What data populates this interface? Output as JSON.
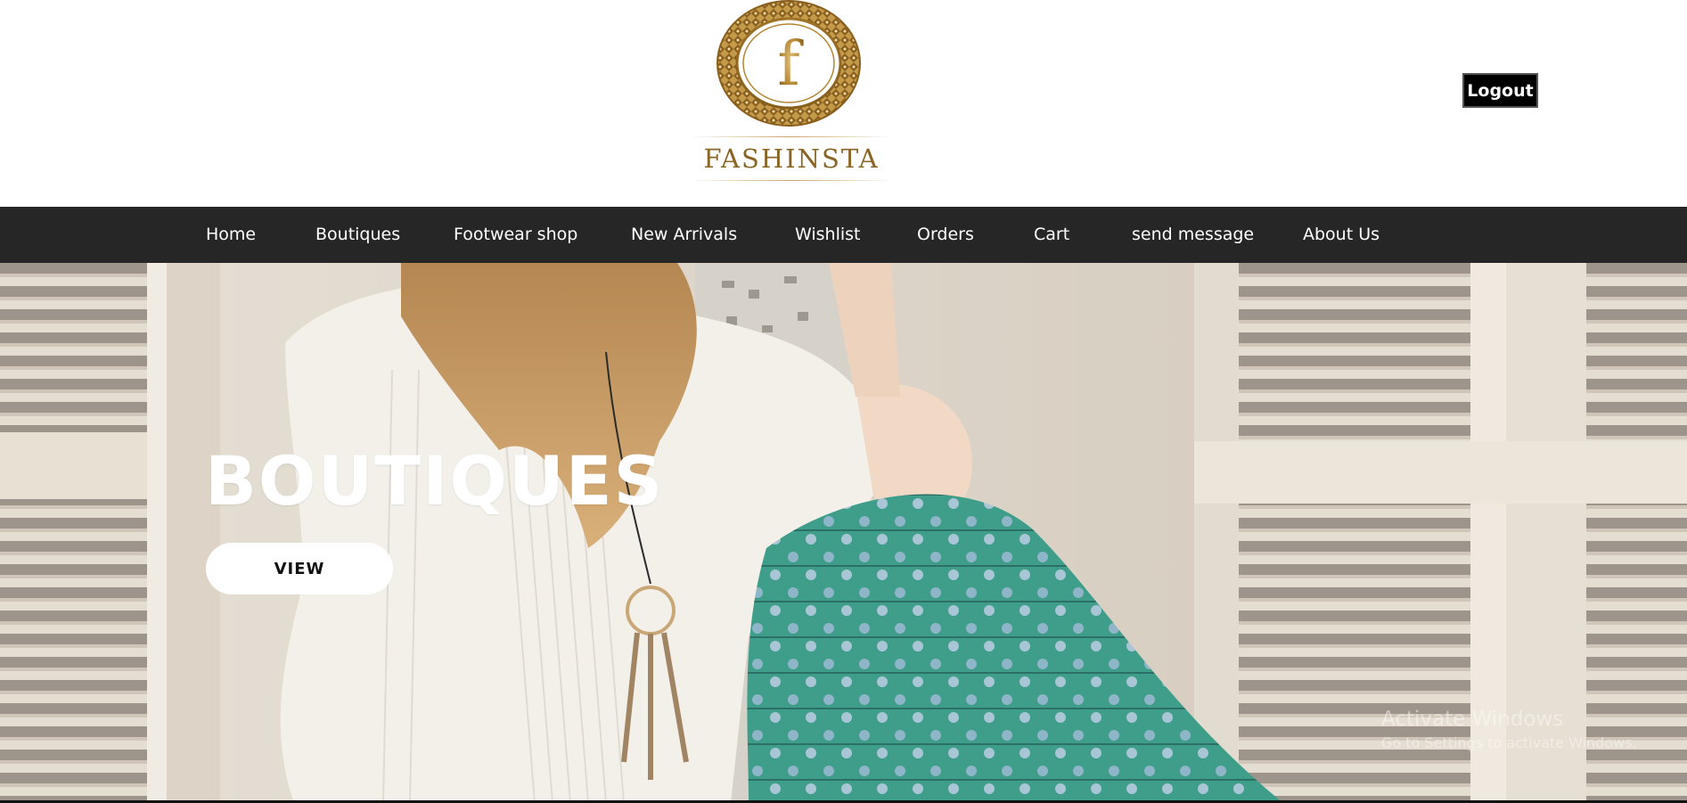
{
  "header": {
    "logo": {
      "monogram": "f",
      "wordmark": "FASHINSTA",
      "emblem_icon": "ornamental-circle-icon",
      "color": "#8a6424"
    },
    "logout_label": "Logout"
  },
  "nav": {
    "items": [
      {
        "label": "Home"
      },
      {
        "label": "Boutiques"
      },
      {
        "label": "Footwear shop"
      },
      {
        "label": "New Arrivals"
      },
      {
        "label": "Wishlist"
      },
      {
        "label": "Orders"
      },
      {
        "label": "Cart"
      },
      {
        "label": "send message"
      },
      {
        "label": "About Us"
      }
    ],
    "background": "#262626"
  },
  "hero": {
    "title": "BOUTIQUES",
    "button_label": "VIEW"
  },
  "watermark": {
    "title": "Activate Windows",
    "subtitle": "Go to Settings to activate Windows."
  },
  "colors": {
    "nav_bg": "#262626",
    "logout_bg": "#000000",
    "gold": "#8a6424"
  }
}
